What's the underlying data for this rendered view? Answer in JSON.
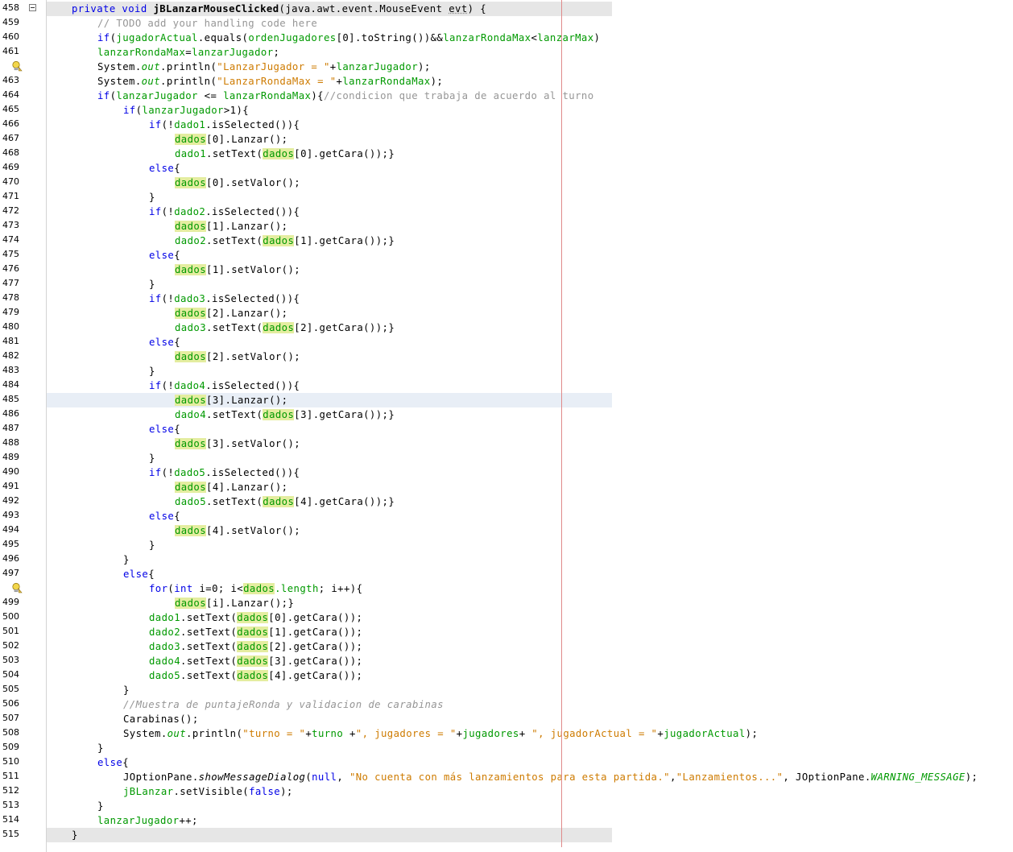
{
  "editor": {
    "lines": [
      {
        "n": "458",
        "indent": 0,
        "fold": true,
        "cls": "first",
        "t": [
          [
            "kw",
            "private void "
          ],
          [
            "b",
            "jBLanzarMouseClicked"
          ],
          [
            "",
            "(java.awt.event.MouseEvent "
          ],
          [
            "u",
            "evt"
          ],
          [
            "",
            ") {"
          ]
        ]
      },
      {
        "n": "459",
        "indent": 1,
        "t": [
          [
            "cmt",
            "// TODO add your handling code here"
          ]
        ]
      },
      {
        "n": "460",
        "indent": 1,
        "t": [
          [
            "kw",
            "if"
          ],
          [
            "",
            "("
          ],
          [
            "fld",
            "jugadorActual"
          ],
          [
            "",
            ".equals("
          ],
          [
            "fld",
            "ordenJugadores"
          ],
          [
            "",
            "[0].toString())&&"
          ],
          [
            "fld",
            "lanzarRondaMax"
          ],
          [
            "",
            "<"
          ],
          [
            "fld",
            "lanzarMax"
          ],
          [
            "",
            ")"
          ]
        ]
      },
      {
        "n": "461",
        "indent": 1,
        "t": [
          [
            "fld",
            "lanzarRondaMax"
          ],
          [
            "",
            "="
          ],
          [
            "fld",
            "lanzarJugador"
          ],
          [
            "",
            ";"
          ]
        ]
      },
      {
        "n": "",
        "indent": 1,
        "bulb": true,
        "t": [
          [
            "",
            "System."
          ],
          [
            "fld it",
            "out"
          ],
          [
            "",
            ".println("
          ],
          [
            "str",
            "\"LanzarJugador = \""
          ],
          [
            "",
            "+"
          ],
          [
            "fld",
            "lanzarJugador"
          ],
          [
            "",
            ");"
          ]
        ]
      },
      {
        "n": "463",
        "indent": 1,
        "t": [
          [
            "",
            "System."
          ],
          [
            "fld it",
            "out"
          ],
          [
            "",
            ".println("
          ],
          [
            "str",
            "\"LanzarRondaMax = \""
          ],
          [
            "",
            "+"
          ],
          [
            "fld",
            "lanzarRondaMax"
          ],
          [
            "",
            ");"
          ]
        ]
      },
      {
        "n": "464",
        "indent": 1,
        "t": [
          [
            "kw",
            "if"
          ],
          [
            "",
            "("
          ],
          [
            "fld",
            "lanzarJugador"
          ],
          [
            "",
            " <= "
          ],
          [
            "fld",
            "lanzarRondaMax"
          ],
          [
            "",
            "){"
          ],
          [
            "cmt",
            "//condicion que trabaja de acuerdo al turno"
          ]
        ]
      },
      {
        "n": "465",
        "indent": 2,
        "t": [
          [
            "kw",
            "if"
          ],
          [
            "",
            "("
          ],
          [
            "fld",
            "lanzarJugador"
          ],
          [
            "",
            ">1){"
          ]
        ]
      },
      {
        "n": "466",
        "indent": 3,
        "t": [
          [
            "kw",
            "if"
          ],
          [
            "",
            "(!"
          ],
          [
            "fld",
            "dado1"
          ],
          [
            "",
            ".isSelected()){"
          ]
        ]
      },
      {
        "n": "467",
        "indent": 4,
        "t": [
          [
            "hi fld",
            "dados"
          ],
          [
            "",
            "[0].Lanzar();"
          ]
        ]
      },
      {
        "n": "468",
        "indent": 4,
        "t": [
          [
            "fld",
            "dado1"
          ],
          [
            "",
            ".setText("
          ],
          [
            "hi fld",
            "dados"
          ],
          [
            "",
            "[0].getCara());}"
          ]
        ]
      },
      {
        "n": "469",
        "indent": 3,
        "t": [
          [
            "kw",
            "else"
          ],
          [
            "",
            "{"
          ]
        ]
      },
      {
        "n": "470",
        "indent": 4,
        "t": [
          [
            "hi fld",
            "dados"
          ],
          [
            "",
            "[0].setValor();"
          ]
        ]
      },
      {
        "n": "471",
        "indent": 3,
        "t": [
          [
            "",
            "}"
          ]
        ]
      },
      {
        "n": "472",
        "indent": 3,
        "t": [
          [
            "kw",
            "if"
          ],
          [
            "",
            "(!"
          ],
          [
            "fld",
            "dado2"
          ],
          [
            "",
            ".isSelected()){"
          ]
        ]
      },
      {
        "n": "473",
        "indent": 4,
        "t": [
          [
            "hi fld",
            "dados"
          ],
          [
            "",
            "[1].Lanzar();"
          ]
        ]
      },
      {
        "n": "474",
        "indent": 4,
        "t": [
          [
            "fld",
            "dado2"
          ],
          [
            "",
            ".setText("
          ],
          [
            "hi fld",
            "dados"
          ],
          [
            "",
            "[1].getCara());}"
          ]
        ]
      },
      {
        "n": "475",
        "indent": 3,
        "t": [
          [
            "kw",
            "else"
          ],
          [
            "",
            "{"
          ]
        ]
      },
      {
        "n": "476",
        "indent": 4,
        "t": [
          [
            "hi fld",
            "dados"
          ],
          [
            "",
            "[1].setValor();"
          ]
        ]
      },
      {
        "n": "477",
        "indent": 3,
        "t": [
          [
            "",
            "}"
          ]
        ]
      },
      {
        "n": "478",
        "indent": 3,
        "t": [
          [
            "kw",
            "if"
          ],
          [
            "",
            "(!"
          ],
          [
            "fld",
            "dado3"
          ],
          [
            "",
            ".isSelected()){"
          ]
        ]
      },
      {
        "n": "479",
        "indent": 4,
        "t": [
          [
            "hi fld",
            "dados"
          ],
          [
            "",
            "[2].Lanzar();"
          ]
        ]
      },
      {
        "n": "480",
        "indent": 4,
        "t": [
          [
            "fld",
            "dado3"
          ],
          [
            "",
            ".setText("
          ],
          [
            "hi fld",
            "dados"
          ],
          [
            "",
            "[2].getCara());}"
          ]
        ]
      },
      {
        "n": "481",
        "indent": 3,
        "t": [
          [
            "kw",
            "else"
          ],
          [
            "",
            "{"
          ]
        ]
      },
      {
        "n": "482",
        "indent": 4,
        "t": [
          [
            "hi fld",
            "dados"
          ],
          [
            "",
            "[2].setValor();"
          ]
        ]
      },
      {
        "n": "483",
        "indent": 3,
        "t": [
          [
            "",
            "}"
          ]
        ]
      },
      {
        "n": "484",
        "indent": 3,
        "t": [
          [
            "kw",
            "if"
          ],
          [
            "",
            "(!"
          ],
          [
            "fld",
            "dado4"
          ],
          [
            "",
            ".isSelected()){"
          ]
        ]
      },
      {
        "n": "485",
        "indent": 4,
        "cls": "hl",
        "t": [
          [
            "hi fld",
            "dados"
          ],
          [
            "",
            "[3].Lanzar();"
          ]
        ]
      },
      {
        "n": "486",
        "indent": 4,
        "t": [
          [
            "fld",
            "dado4"
          ],
          [
            "",
            ".setText("
          ],
          [
            "hi fld",
            "dados"
          ],
          [
            "",
            "[3].getCara());}"
          ]
        ]
      },
      {
        "n": "487",
        "indent": 3,
        "t": [
          [
            "kw",
            "else"
          ],
          [
            "",
            "{"
          ]
        ]
      },
      {
        "n": "488",
        "indent": 4,
        "t": [
          [
            "hi fld",
            "dados"
          ],
          [
            "",
            "[3].setValor();"
          ]
        ]
      },
      {
        "n": "489",
        "indent": 3,
        "t": [
          [
            "",
            "}"
          ]
        ]
      },
      {
        "n": "490",
        "indent": 3,
        "t": [
          [
            "kw",
            "if"
          ],
          [
            "",
            "(!"
          ],
          [
            "fld",
            "dado5"
          ],
          [
            "",
            ".isSelected()){"
          ]
        ]
      },
      {
        "n": "491",
        "indent": 4,
        "t": [
          [
            "hi fld",
            "dados"
          ],
          [
            "",
            "[4].Lanzar();"
          ]
        ]
      },
      {
        "n": "492",
        "indent": 4,
        "t": [
          [
            "fld",
            "dado5"
          ],
          [
            "",
            ".setText("
          ],
          [
            "hi fld",
            "dados"
          ],
          [
            "",
            "[4].getCara());}"
          ]
        ]
      },
      {
        "n": "493",
        "indent": 3,
        "t": [
          [
            "kw",
            "else"
          ],
          [
            "",
            "{"
          ]
        ]
      },
      {
        "n": "494",
        "indent": 4,
        "t": [
          [
            "hi fld",
            "dados"
          ],
          [
            "",
            "[4].setValor();"
          ]
        ]
      },
      {
        "n": "495",
        "indent": 3,
        "t": [
          [
            "",
            "}"
          ]
        ]
      },
      {
        "n": "496",
        "indent": 2,
        "t": [
          [
            "",
            "}"
          ]
        ]
      },
      {
        "n": "497",
        "indent": 2,
        "t": [
          [
            "kw",
            "else"
          ],
          [
            "",
            "{"
          ]
        ]
      },
      {
        "n": "",
        "indent": 3,
        "bulb": true,
        "t": [
          [
            "kw",
            "for"
          ],
          [
            "",
            "("
          ],
          [
            "kw",
            "int"
          ],
          [
            "",
            " i=0; i<"
          ],
          [
            "hi fld",
            "dados"
          ],
          [
            "fld",
            ".length"
          ],
          [
            "",
            "; i++){"
          ]
        ]
      },
      {
        "n": "499",
        "indent": 4,
        "t": [
          [
            "hi fld",
            "dados"
          ],
          [
            "",
            "[i].Lanzar();}"
          ]
        ]
      },
      {
        "n": "500",
        "indent": 3,
        "t": [
          [
            "fld",
            "dado1"
          ],
          [
            "",
            ".setText("
          ],
          [
            "hi fld",
            "dados"
          ],
          [
            "",
            "[0].getCara());"
          ]
        ]
      },
      {
        "n": "501",
        "indent": 3,
        "t": [
          [
            "fld",
            "dado2"
          ],
          [
            "",
            ".setText("
          ],
          [
            "hi fld",
            "dados"
          ],
          [
            "",
            "[1].getCara());"
          ]
        ]
      },
      {
        "n": "502",
        "indent": 3,
        "t": [
          [
            "fld",
            "dado3"
          ],
          [
            "",
            ".setText("
          ],
          [
            "hi fld",
            "dados"
          ],
          [
            "",
            "[2].getCara());"
          ]
        ]
      },
      {
        "n": "503",
        "indent": 3,
        "t": [
          [
            "fld",
            "dado4"
          ],
          [
            "",
            ".setText("
          ],
          [
            "hi fld",
            "dados"
          ],
          [
            "",
            "[3].getCara());"
          ]
        ]
      },
      {
        "n": "504",
        "indent": 3,
        "t": [
          [
            "fld",
            "dado5"
          ],
          [
            "",
            ".setText("
          ],
          [
            "hi fld",
            "dados"
          ],
          [
            "",
            "[4].getCara());"
          ]
        ]
      },
      {
        "n": "505",
        "indent": 2,
        "t": [
          [
            "",
            "}"
          ]
        ]
      },
      {
        "n": "506",
        "indent": 2,
        "t": [
          [
            "cmt it",
            "//Muestra de puntajeRonda y validacion de carabinas"
          ]
        ]
      },
      {
        "n": "507",
        "indent": 2,
        "t": [
          [
            "",
            "Carabinas();"
          ]
        ]
      },
      {
        "n": "508",
        "indent": 2,
        "t": [
          [
            "",
            "System."
          ],
          [
            "fld it",
            "out"
          ],
          [
            "",
            ".println("
          ],
          [
            "str",
            "\"turno = \""
          ],
          [
            "",
            "+"
          ],
          [
            "fld",
            "turno"
          ],
          [
            "",
            " +"
          ],
          [
            "str",
            "\", jugadores = \""
          ],
          [
            "",
            "+"
          ],
          [
            "fld",
            "jugadores"
          ],
          [
            "",
            "+ "
          ],
          [
            "str",
            "\", jugadorActual = \""
          ],
          [
            "",
            "+"
          ],
          [
            "fld",
            "jugadorActual"
          ],
          [
            "",
            ");"
          ]
        ]
      },
      {
        "n": "509",
        "indent": 1,
        "t": [
          [
            "",
            "}"
          ]
        ]
      },
      {
        "n": "510",
        "indent": 1,
        "t": [
          [
            "kw",
            "else"
          ],
          [
            "",
            "{"
          ]
        ]
      },
      {
        "n": "511",
        "indent": 2,
        "t": [
          [
            "",
            "JOptionPane."
          ],
          [
            "it",
            "showMessageDialog"
          ],
          [
            "",
            "("
          ],
          [
            "kw",
            "null"
          ],
          [
            "",
            ", "
          ],
          [
            "str",
            "\"No cuenta con más lanzamientos para esta partida.\""
          ],
          [
            "",
            ","
          ],
          [
            "str",
            "\"Lanzamientos...\""
          ],
          [
            "",
            ", JOptionPane."
          ],
          [
            "fld it",
            "WARNING_MESSAGE"
          ],
          [
            "",
            ");"
          ]
        ]
      },
      {
        "n": "512",
        "indent": 2,
        "t": [
          [
            "fld",
            "jBLanzar"
          ],
          [
            "",
            ".setVisible("
          ],
          [
            "kw",
            "false"
          ],
          [
            "",
            ");"
          ]
        ]
      },
      {
        "n": "513",
        "indent": 1,
        "t": [
          [
            "",
            "}"
          ]
        ]
      },
      {
        "n": "514",
        "indent": 1,
        "t": [
          [
            "fld",
            "lanzarJugador"
          ],
          [
            "",
            "++;"
          ]
        ]
      },
      {
        "n": "515",
        "indent": 0,
        "cls": "last",
        "t": [
          [
            "",
            "}"
          ]
        ]
      }
    ]
  }
}
